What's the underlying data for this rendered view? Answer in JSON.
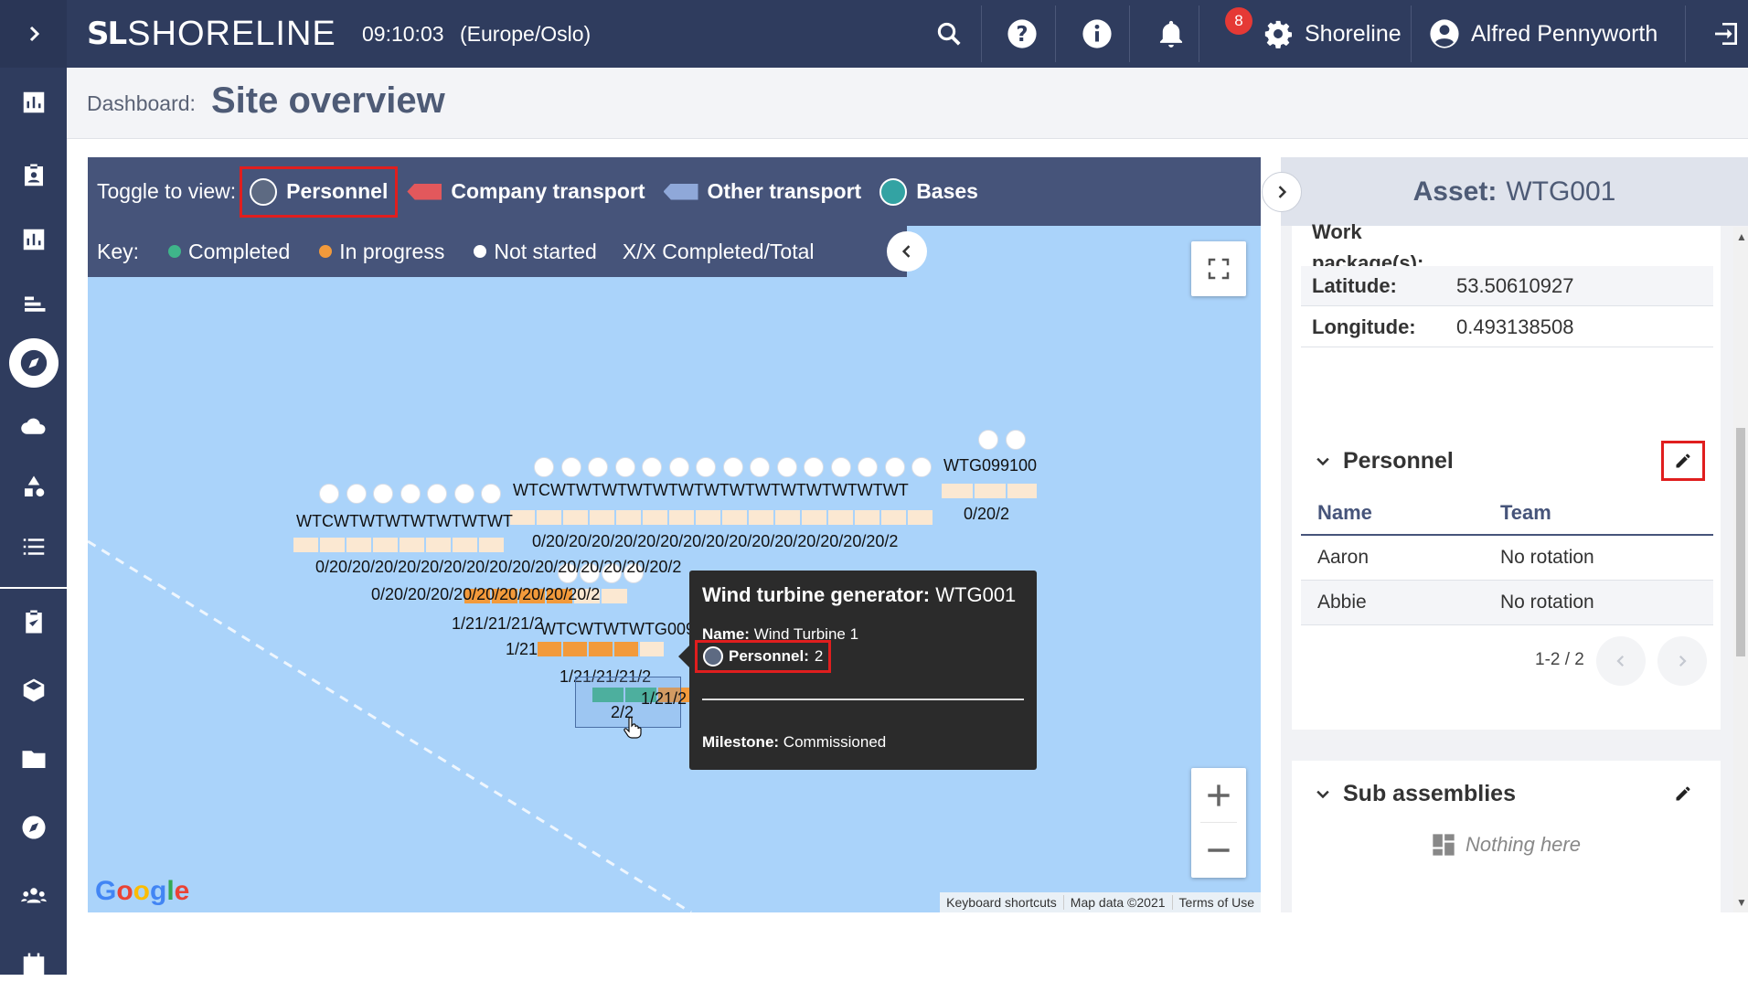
{
  "topbar": {
    "logo_mark": "SL",
    "logo_text": "SHORELINE",
    "clock": "09:10:03",
    "timezone": "(Europe/Oslo)",
    "notification_count": "8",
    "tenant": "Shoreline",
    "user": "Alfred Pennyworth"
  },
  "header": {
    "crumb": "Dashboard:",
    "title": "Site overview"
  },
  "map": {
    "toggle_label": "Toggle to view:",
    "toggles": [
      "Personnel",
      "Company transport",
      "Other transport",
      "Bases"
    ],
    "key_label": "Key:",
    "key_items": [
      "Completed",
      "In progress",
      "Not started",
      "X/X Completed/Total"
    ],
    "key_colors": {
      "completed": "#3fb58a",
      "in_progress": "#f29a3b",
      "not_started": "#ffffff"
    },
    "labels": {
      "wtg_top": "WTG099100",
      "cluster_right": "0/20/2",
      "row_a": "0/20/20/20/20/20/20/20/20/20/20/20/20/20/20/20/2",
      "row_b": "0/20/20/20/20/20/20/20/20/20/20/20/20/20/20/20/2",
      "row_c": "0/20/20/20/20/20/20/20/20/20/2",
      "wtg_row1": "WTCWTWTWTWTWTWTWTWTWTWTWTWTWTWT",
      "wtg_row2": "WTCWTWTWTWTWTWTWT",
      "wtg_row3": "WTCWTWTWTG0091",
      "row_d": "1/21/21/21/2",
      "row_e": "1/21",
      "row_f": "1/21/21/21/2",
      "row_g": "2/2",
      "row_h": "1/21/2"
    },
    "tooltip": {
      "title_prefix": "Wind turbine generator:",
      "title_value": "WTG001",
      "name_label": "Name:",
      "name_value": "Wind Turbine 1",
      "personnel_label": "Personnel:",
      "personnel_value": "2",
      "milestone_label": "Milestone:",
      "milestone_value": "Commissioned"
    },
    "google": "Google",
    "attribution": [
      "Keyboard shortcuts",
      "Map data ©2021",
      "Terms of Use"
    ]
  },
  "asset": {
    "label": "Asset:",
    "id": "WTG001",
    "work_package_label": "Work package(s):",
    "properties": [
      {
        "key": "Latitude:",
        "value": "53.50610927"
      },
      {
        "key": "Longitude:",
        "value": "0.493138508"
      }
    ]
  },
  "personnel": {
    "title": "Personnel",
    "columns": [
      "Name",
      "Team"
    ],
    "rows": [
      {
        "name": "Aaron",
        "team": "No rotation"
      },
      {
        "name": "Abbie",
        "team": "No rotation"
      }
    ],
    "pager": "1-2 / 2"
  },
  "sub_assemblies": {
    "title": "Sub assemblies",
    "empty": "Nothing here"
  },
  "sidebar": [
    "expand",
    "dashboard",
    "bookings",
    "reports",
    "gantt",
    "map",
    "weather",
    "assets",
    "lists",
    "tasks",
    "packages",
    "documents",
    "navigation",
    "people",
    "calendar"
  ]
}
